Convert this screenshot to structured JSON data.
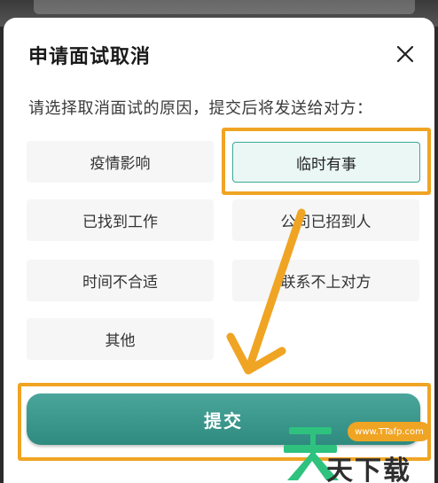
{
  "dialog": {
    "title": "申请面试取消",
    "subtitle": "请选择取消面试的原因，提交后将发送给对方：",
    "close_icon": "close-icon",
    "options": [
      {
        "label": "疫情影响",
        "selected": false
      },
      {
        "label": "临时有事",
        "selected": true
      },
      {
        "label": "已找到工作",
        "selected": false
      },
      {
        "label": "公司已招到人",
        "selected": false
      },
      {
        "label": "时间不合适",
        "selected": false
      },
      {
        "label": "联系不上对方",
        "selected": false
      },
      {
        "label": "其他",
        "selected": false
      }
    ],
    "submit_label": "提交"
  },
  "annotation": {
    "highlight_color": "#f0a423",
    "arrow_icon": "arrow-down-left-icon"
  },
  "watermark": {
    "url": "www.TTafp.com",
    "text": "天下载",
    "logo_icon": "tian-logo-icon"
  },
  "colors": {
    "accent": "#2f8a7f",
    "selected_border": "#3aa898",
    "selected_bg": "#eaf7f5",
    "option_bg": "#f5f6f5"
  }
}
